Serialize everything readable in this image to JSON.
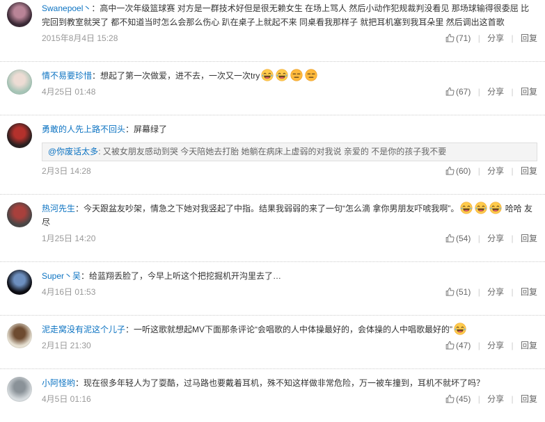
{
  "comments": [
    {
      "username": "Swanepoel丶",
      "text": "：高中一次年级篮球赛 对方是一群技术好但是很无赖女生 在场上骂人 然后小动作犯规裁判没看见 那场球输得很委屈 比完回到教室就哭了 都不知道当时怎么会那么伤心 趴在桌子上就起不来 同桌看我那样子 就把耳机塞到我耳朵里 然后调出这首歌",
      "time": "2015年8月4日 15:28",
      "likes": "(71)",
      "avatar": {
        "bg": "#3a2935",
        "fg": "#b98497"
      }
    },
    {
      "username": "情不易要珍惜",
      "text": "：想起了第一次做爱，进不去，一次又一次try",
      "emojis": [
        "laughing",
        "laughing",
        "expressionless",
        "expressionless"
      ],
      "time": "4月25日 01:48",
      "likes": "(67)",
      "avatar": {
        "bg": "#a6c4b6",
        "fg": "#eddcd4"
      }
    },
    {
      "username": "勇敢的人先上路不回头",
      "text": "：屏幕绿了",
      "quote": {
        "user": "@你废话太多",
        "text": ": 又被女朋友感动到哭 今天陪她去打胎 她躺在病床上虚弱的对我说 亲爱的 不是你的孩子我不要"
      },
      "time": "2月3日 14:28",
      "likes": "(60)",
      "avatar": {
        "bg": "#2a2020",
        "fg": "#b3312c"
      }
    },
    {
      "username": "热河先生",
      "text": "：今天跟盆友吵架，情急之下她对我竖起了中指。结果我弱弱的来了一句“怎么滴 拿你男朋友吓唬我啊”。",
      "emojis": [
        "laughing",
        "laughing",
        "laughing"
      ],
      "text_after": " 哈哈 友尽",
      "time": "1月25日 14:20",
      "likes": "(54)",
      "avatar": {
        "bg": "#4a4646",
        "fg": "#a8403c"
      }
    },
    {
      "username": "Super丶吴",
      "text": "：给蓝翔丢脸了，今早上听这个把挖掘机开沟里去了…",
      "time": "4月16日 01:53",
      "likes": "(51)",
      "avatar": {
        "bg": "#0d0d13",
        "fg": "#6d8fbf"
      }
    },
    {
      "username": "泥走窝没有泥这个儿子",
      "text": "：一听这歌就想起MV下面那条评论“会唱歌的人中体操最好的，会体操的人中唱歌最好的”",
      "emojis": [
        "laughing"
      ],
      "time": "2月1日 21:30",
      "likes": "(47)",
      "avatar": {
        "bg": "#e6e0d2",
        "fg": "#6e4b30"
      }
    },
    {
      "username": "小阿怪哟",
      "text": "：现在很多年轻人为了耍酷，过马路也要戴着耳机，殊不知这样做非常危险，万一被车撞到，耳机不就坏了吗？",
      "time": "4月5日 01:16",
      "likes": "(45)",
      "avatar": {
        "bg": "#d6dbde",
        "fg": "#8a9298"
      }
    }
  ],
  "actions": {
    "share": "分享",
    "reply": "回复",
    "separator": "|"
  }
}
